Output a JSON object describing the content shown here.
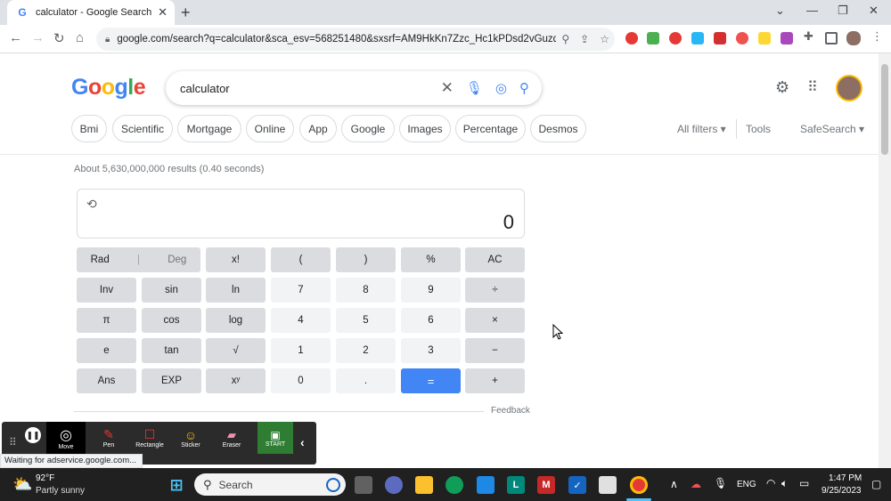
{
  "browser": {
    "tab_title": "calculator - Google Search",
    "tab_favicon": "G",
    "close_glyph": "✕",
    "newtab_glyph": "+",
    "url": "google.com/search?q=calculator&sca_esv=568251480&sxsrf=AM9HkKn7Zzc_Hc1kPDsd2vGuzqC...",
    "window_controls": [
      "⌄",
      "—",
      "❐",
      "✕"
    ]
  },
  "google": {
    "logo": [
      "G",
      "o",
      "o",
      "g",
      "l",
      "e"
    ],
    "logo_colors": [
      "#4285f4",
      "#ea4335",
      "#fbbc05",
      "#4285f4",
      "#34a853",
      "#ea4335"
    ],
    "query": "calculator",
    "chips": [
      "Bmi",
      "Scientific",
      "Mortgage",
      "Online",
      "App",
      "Google",
      "Images",
      "Percentage",
      "Desmos"
    ],
    "all_filters": "All filters ▾",
    "tools": "Tools",
    "safesearch": "SafeSearch ▾",
    "stats": "About 5,630,000,000 results (0.40 seconds)"
  },
  "calculator": {
    "display": "0",
    "rows": [
      [
        {
          "l": "Rad",
          "t": "fn"
        },
        {
          "l": "Deg",
          "t": "fn"
        },
        {
          "l": "x!",
          "t": "fn"
        },
        {
          "l": "(",
          "t": "fn"
        },
        {
          "l": ")",
          "t": "fn"
        },
        {
          "l": "%",
          "t": "fn"
        },
        {
          "l": "AC",
          "t": "fn"
        }
      ],
      [
        {
          "l": "Inv",
          "t": "fn"
        },
        {
          "l": "sin",
          "t": "fn"
        },
        {
          "l": "ln",
          "t": "fn"
        },
        {
          "l": "7",
          "t": "num"
        },
        {
          "l": "8",
          "t": "num"
        },
        {
          "l": "9",
          "t": "num"
        },
        {
          "l": "÷",
          "t": "fn"
        }
      ],
      [
        {
          "l": "π",
          "t": "fn"
        },
        {
          "l": "cos",
          "t": "fn"
        },
        {
          "l": "log",
          "t": "fn"
        },
        {
          "l": "4",
          "t": "num"
        },
        {
          "l": "5",
          "t": "num"
        },
        {
          "l": "6",
          "t": "num"
        },
        {
          "l": "×",
          "t": "fn"
        }
      ],
      [
        {
          "l": "e",
          "t": "fn"
        },
        {
          "l": "tan",
          "t": "fn"
        },
        {
          "l": "√",
          "t": "fn"
        },
        {
          "l": "1",
          "t": "num"
        },
        {
          "l": "2",
          "t": "num"
        },
        {
          "l": "3",
          "t": "num"
        },
        {
          "l": "−",
          "t": "fn"
        }
      ],
      [
        {
          "l": "Ans",
          "t": "fn"
        },
        {
          "l": "EXP",
          "t": "fn"
        },
        {
          "l": "xʸ",
          "t": "fn"
        },
        {
          "l": "0",
          "t": "num"
        },
        {
          "l": ".",
          "t": "num"
        },
        {
          "l": "=",
          "t": "eq"
        },
        {
          "l": "+",
          "t": "fn"
        }
      ]
    ],
    "feedback": "Feedback"
  },
  "status_text": "Waiting for adservice.google.com...",
  "floating_toolbar": {
    "items": [
      "Move",
      "Pen",
      "Rectangle",
      "Sticker",
      "Eraser",
      "START"
    ]
  },
  "taskbar": {
    "weather_temp": "92°F",
    "weather_desc": "Partly sunny",
    "search_label": "Search",
    "language": "ENG",
    "time": "1:47 PM",
    "date": "9/25/2023"
  }
}
